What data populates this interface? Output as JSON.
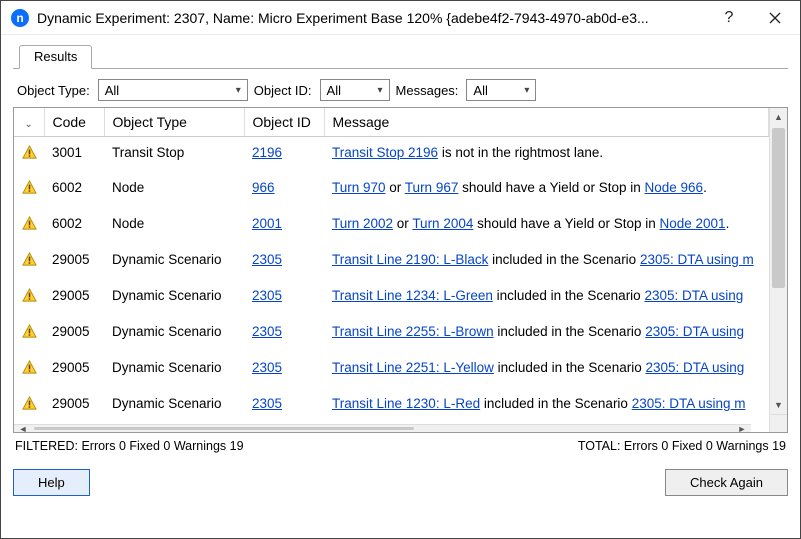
{
  "window": {
    "title": "Dynamic Experiment: 2307, Name: Micro Experiment Base 120%  {adebe4f2-7943-4970-ab0d-e3..."
  },
  "tabs": {
    "results": "Results"
  },
  "filters": {
    "object_type_label": "Object Type:",
    "object_type_value": "All",
    "object_id_label": "Object ID:",
    "object_id_value": "All",
    "messages_label": "Messages:",
    "messages_value": "All"
  },
  "columns": {
    "icon": "",
    "code": "Code",
    "otype": "Object Type",
    "oid": "Object ID",
    "msg": "Message"
  },
  "rows": [
    {
      "code": "3001",
      "otype": "Transit Stop",
      "oid": "2196",
      "msg_parts": [
        {
          "t": "link",
          "text": "Transit Stop 2196"
        },
        {
          "t": "text",
          "text": " is not in the rightmost lane."
        }
      ]
    },
    {
      "code": "6002",
      "otype": "Node",
      "oid": "966",
      "msg_parts": [
        {
          "t": "link",
          "text": "Turn 970"
        },
        {
          "t": "text",
          "text": " or "
        },
        {
          "t": "link",
          "text": "Turn 967"
        },
        {
          "t": "text",
          "text": " should have a Yield or Stop in "
        },
        {
          "t": "link",
          "text": "Node 966"
        },
        {
          "t": "text",
          "text": "."
        }
      ]
    },
    {
      "code": "6002",
      "otype": "Node",
      "oid": "2001",
      "msg_parts": [
        {
          "t": "link",
          "text": "Turn 2002"
        },
        {
          "t": "text",
          "text": " or "
        },
        {
          "t": "link",
          "text": "Turn 2004"
        },
        {
          "t": "text",
          "text": " should have a Yield or Stop in "
        },
        {
          "t": "link",
          "text": "Node 2001"
        },
        {
          "t": "text",
          "text": "."
        }
      ]
    },
    {
      "code": "29005",
      "otype": "Dynamic Scenario",
      "oid": "2305",
      "msg_parts": [
        {
          "t": "link",
          "text": "Transit Line 2190: L-Black"
        },
        {
          "t": "text",
          "text": " included in the Scenario "
        },
        {
          "t": "link",
          "text": "2305: DTA using m"
        }
      ]
    },
    {
      "code": "29005",
      "otype": "Dynamic Scenario",
      "oid": "2305",
      "msg_parts": [
        {
          "t": "link",
          "text": "Transit Line 1234: L-Green"
        },
        {
          "t": "text",
          "text": " included in the Scenario "
        },
        {
          "t": "link",
          "text": "2305: DTA using "
        }
      ]
    },
    {
      "code": "29005",
      "otype": "Dynamic Scenario",
      "oid": "2305",
      "msg_parts": [
        {
          "t": "link",
          "text": "Transit Line 2255: L-Brown"
        },
        {
          "t": "text",
          "text": " included in the Scenario "
        },
        {
          "t": "link",
          "text": "2305: DTA using "
        }
      ]
    },
    {
      "code": "29005",
      "otype": "Dynamic Scenario",
      "oid": "2305",
      "msg_parts": [
        {
          "t": "link",
          "text": "Transit Line 2251: L-Yellow"
        },
        {
          "t": "text",
          "text": " included in the Scenario "
        },
        {
          "t": "link",
          "text": "2305: DTA using "
        }
      ]
    },
    {
      "code": "29005",
      "otype": "Dynamic Scenario",
      "oid": "2305",
      "msg_parts": [
        {
          "t": "link",
          "text": "Transit Line 1230: L-Red"
        },
        {
          "t": "text",
          "text": " included in the Scenario "
        },
        {
          "t": "link",
          "text": "2305: DTA using m"
        }
      ]
    }
  ],
  "status": {
    "filtered": "FILTERED:  Errors 0  Fixed 0  Warnings 19",
    "total": "TOTAL:  Errors 0  Fixed 0  Warnings 19"
  },
  "buttons": {
    "help": "Help",
    "check_again": "Check Again"
  }
}
